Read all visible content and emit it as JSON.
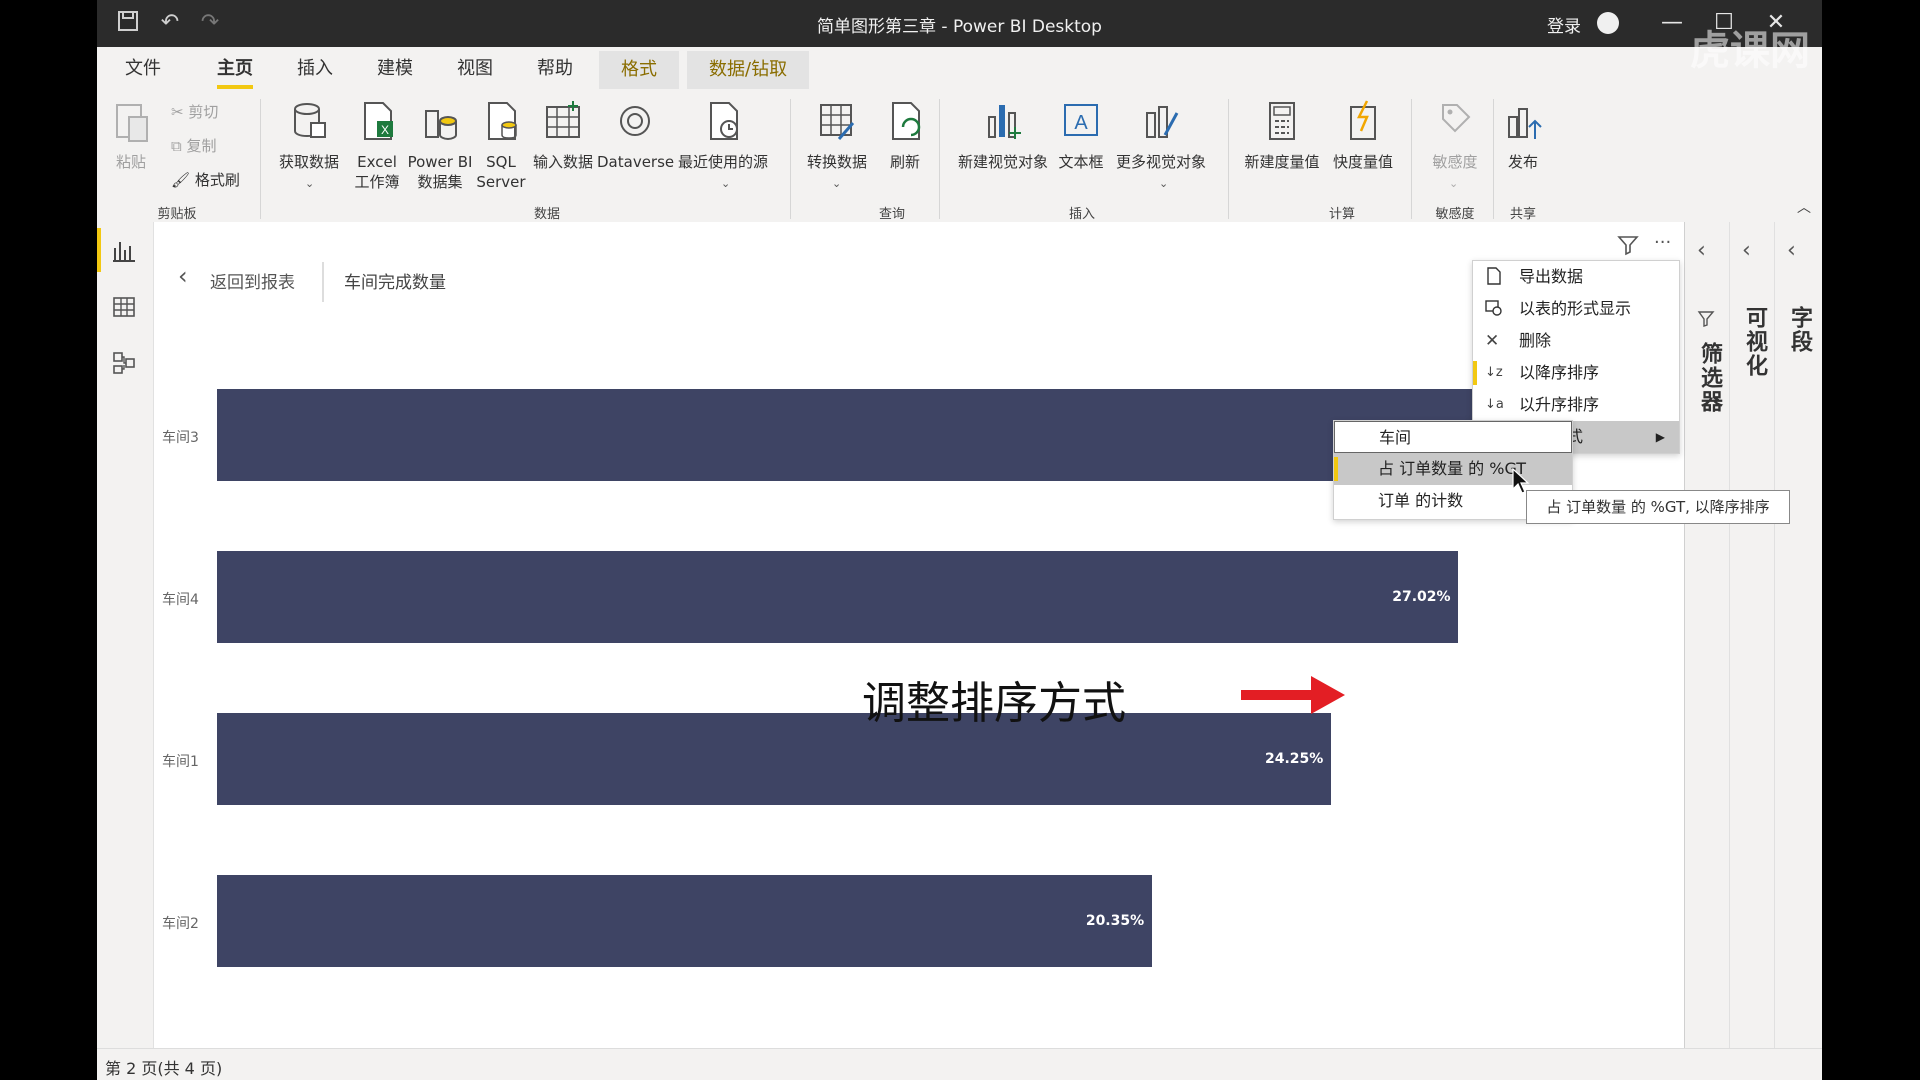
{
  "window": {
    "title": "简单图形第三章 - Power BI Desktop",
    "signin": "登录"
  },
  "menu": {
    "tabs": [
      "文件",
      "主页",
      "插入",
      "建模",
      "视图",
      "帮助",
      "格式",
      "数据/钻取"
    ],
    "active_index": 1
  },
  "ribbon": {
    "clipboard": {
      "paste": "粘贴",
      "cut": "剪切",
      "copy": "复制",
      "format_painter": "格式刷",
      "group": "剪贴板"
    },
    "data": {
      "get_data": "获取数据",
      "excel_1": "Excel",
      "excel_2": "工作簿",
      "pbi_1": "Power BI",
      "pbi_2": "数据集",
      "sql_1": "SQL",
      "sql_2": "Server",
      "enter_data": "输入数据",
      "dataverse": "Dataverse",
      "recent": "最近使用的源",
      "group": "数据"
    },
    "query": {
      "transform": "转换数据",
      "refresh": "刷新",
      "group": "查询"
    },
    "insert": {
      "new_visual": "新建视觉对象",
      "textbox": "文本框",
      "more_visuals": "更多视觉对象",
      "group": "插入"
    },
    "calc": {
      "new_measure": "新建度量值",
      "quick_measure": "快度量值",
      "group": "计算"
    },
    "sensitivity": {
      "label": "敏感度",
      "group": "敏感度"
    },
    "share": {
      "publish": "发布",
      "group": "共享"
    }
  },
  "canvas": {
    "back_label": "返回到报表",
    "breadcrumb": "车间完成数量",
    "annotation": "调整排序方式"
  },
  "chart_data": {
    "type": "bar",
    "orientation": "horizontal",
    "categories": [
      "车间3",
      "车间4",
      "车间1",
      "车间2"
    ],
    "values": [
      28.38,
      27.02,
      24.25,
      20.35
    ],
    "data_labels": [
      "",
      "27.02%",
      "24.25%",
      "20.35%"
    ],
    "xlim": [
      0,
      32
    ]
  },
  "context_menu": {
    "items": [
      {
        "icon": "export-icon",
        "label": "导出数据"
      },
      {
        "icon": "table-view-icon",
        "label": "以表的形式显示"
      },
      {
        "icon": "delete-icon",
        "label": "删除"
      },
      {
        "icon": "sort-desc-icon",
        "label": "以降序排序"
      },
      {
        "icon": "sort-asc-icon",
        "label": "以升序排序"
      },
      {
        "icon": "",
        "label": "排序方式"
      }
    ]
  },
  "sort_submenu": {
    "items": [
      "车间",
      "占 订单数量 的 %GT",
      "订单 的计数"
    ],
    "highlighted_index": 1
  },
  "tooltip": "占 订单数量 的 %GT, 以降序排序",
  "right_panels": [
    "筛选器",
    "可视化",
    "字段"
  ],
  "status": "第 2 页(共 4 页)",
  "watermark": "虎课网",
  "colors": {
    "bar": "#3e4464",
    "accent": "#f2c811",
    "arrow": "#e31e24"
  }
}
